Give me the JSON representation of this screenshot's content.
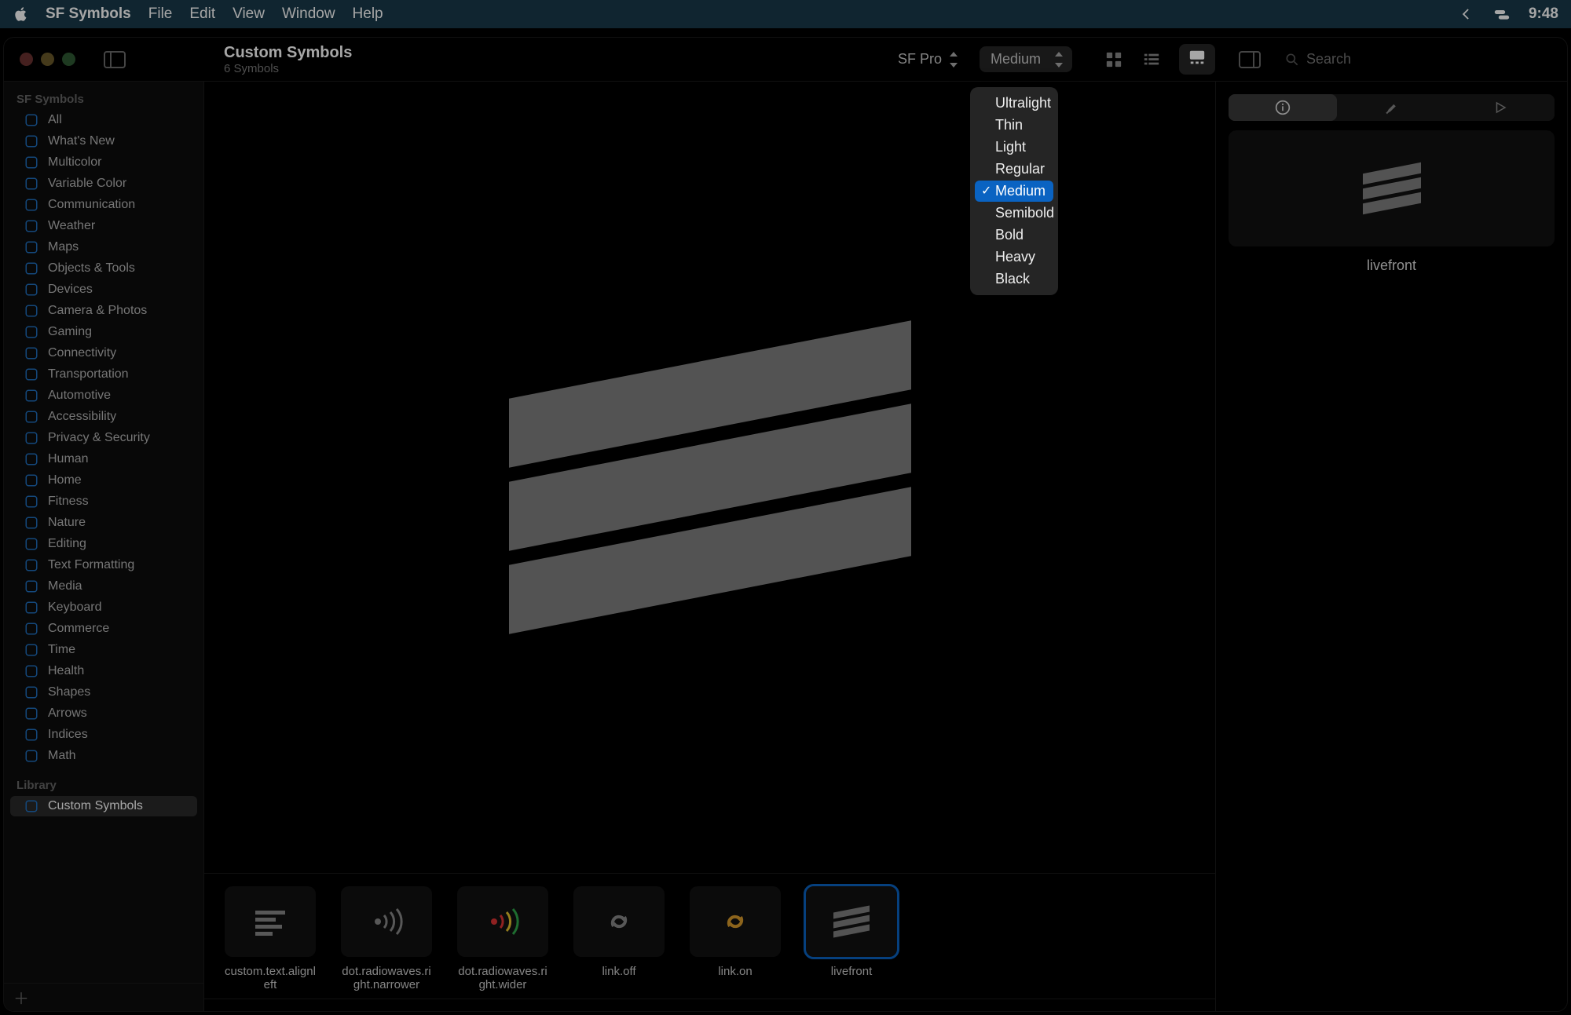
{
  "menubar": {
    "app_name": "SF Symbols",
    "items": [
      "File",
      "Edit",
      "View",
      "Window",
      "Help"
    ],
    "clock": "9:48"
  },
  "toolbar": {
    "title": "Custom Symbols",
    "subtitle": "6 Symbols",
    "font_popup": "SF Pro",
    "weight_popup": "Medium",
    "search_placeholder": "Search"
  },
  "sidebar": {
    "section1_header": "SF Symbols",
    "categories": [
      {
        "icon": "grid",
        "label": "All"
      },
      {
        "icon": "sparkle",
        "label": "What's New"
      },
      {
        "icon": "paint",
        "label": "Multicolor"
      },
      {
        "icon": "slider",
        "label": "Variable Color"
      },
      {
        "icon": "bubble",
        "label": "Communication"
      },
      {
        "icon": "cloud",
        "label": "Weather"
      },
      {
        "icon": "map",
        "label": "Maps"
      },
      {
        "icon": "wrench",
        "label": "Objects & Tools"
      },
      {
        "icon": "device",
        "label": "Devices"
      },
      {
        "icon": "camera",
        "label": "Camera & Photos"
      },
      {
        "icon": "game",
        "label": "Gaming"
      },
      {
        "icon": "wifi",
        "label": "Connectivity"
      },
      {
        "icon": "car",
        "label": "Transportation"
      },
      {
        "icon": "steer",
        "label": "Automotive"
      },
      {
        "icon": "access",
        "label": "Accessibility"
      },
      {
        "icon": "lock",
        "label": "Privacy & Security"
      },
      {
        "icon": "person",
        "label": "Human"
      },
      {
        "icon": "house",
        "label": "Home"
      },
      {
        "icon": "flame",
        "label": "Fitness"
      },
      {
        "icon": "leaf",
        "label": "Nature"
      },
      {
        "icon": "pencil",
        "label": "Editing"
      },
      {
        "icon": "text",
        "label": "Text Formatting"
      },
      {
        "icon": "play",
        "label": "Media"
      },
      {
        "icon": "keyboard",
        "label": "Keyboard"
      },
      {
        "icon": "cart",
        "label": "Commerce"
      },
      {
        "icon": "clock",
        "label": "Time"
      },
      {
        "icon": "heart",
        "label": "Health"
      },
      {
        "icon": "shape",
        "label": "Shapes"
      },
      {
        "icon": "arrow",
        "label": "Arrows"
      },
      {
        "icon": "index",
        "label": "Indices"
      },
      {
        "icon": "fx",
        "label": "Math"
      }
    ],
    "section2_header": "Library",
    "library": [
      {
        "icon": "square",
        "label": "Custom Symbols",
        "selected": true
      }
    ]
  },
  "weight_dropdown": {
    "options": [
      "Ultralight",
      "Thin",
      "Light",
      "Regular",
      "Medium",
      "Semibold",
      "Bold",
      "Heavy",
      "Black"
    ],
    "selected": "Medium"
  },
  "inspector": {
    "selected_name": "livefront"
  },
  "thumbnails": [
    {
      "name": "custom.text.alignleft",
      "kind": "textalign"
    },
    {
      "name": "dot.radiowaves.right.narrower",
      "kind": "radio-narrow"
    },
    {
      "name": "dot.radiowaves.right.wider",
      "kind": "radio-wide"
    },
    {
      "name": "link.off",
      "kind": "link-off"
    },
    {
      "name": "link.on",
      "kind": "link-on"
    },
    {
      "name": "livefront",
      "kind": "livefront",
      "selected": true
    }
  ],
  "colors": {
    "accent": "#0a63c2",
    "sidebar_icon": "#1f6fbf",
    "link_on": "#d79a2b",
    "radio_inner": "#d33",
    "radio_mid": "#e6c22e",
    "radio_outer": "#2fa84a"
  }
}
